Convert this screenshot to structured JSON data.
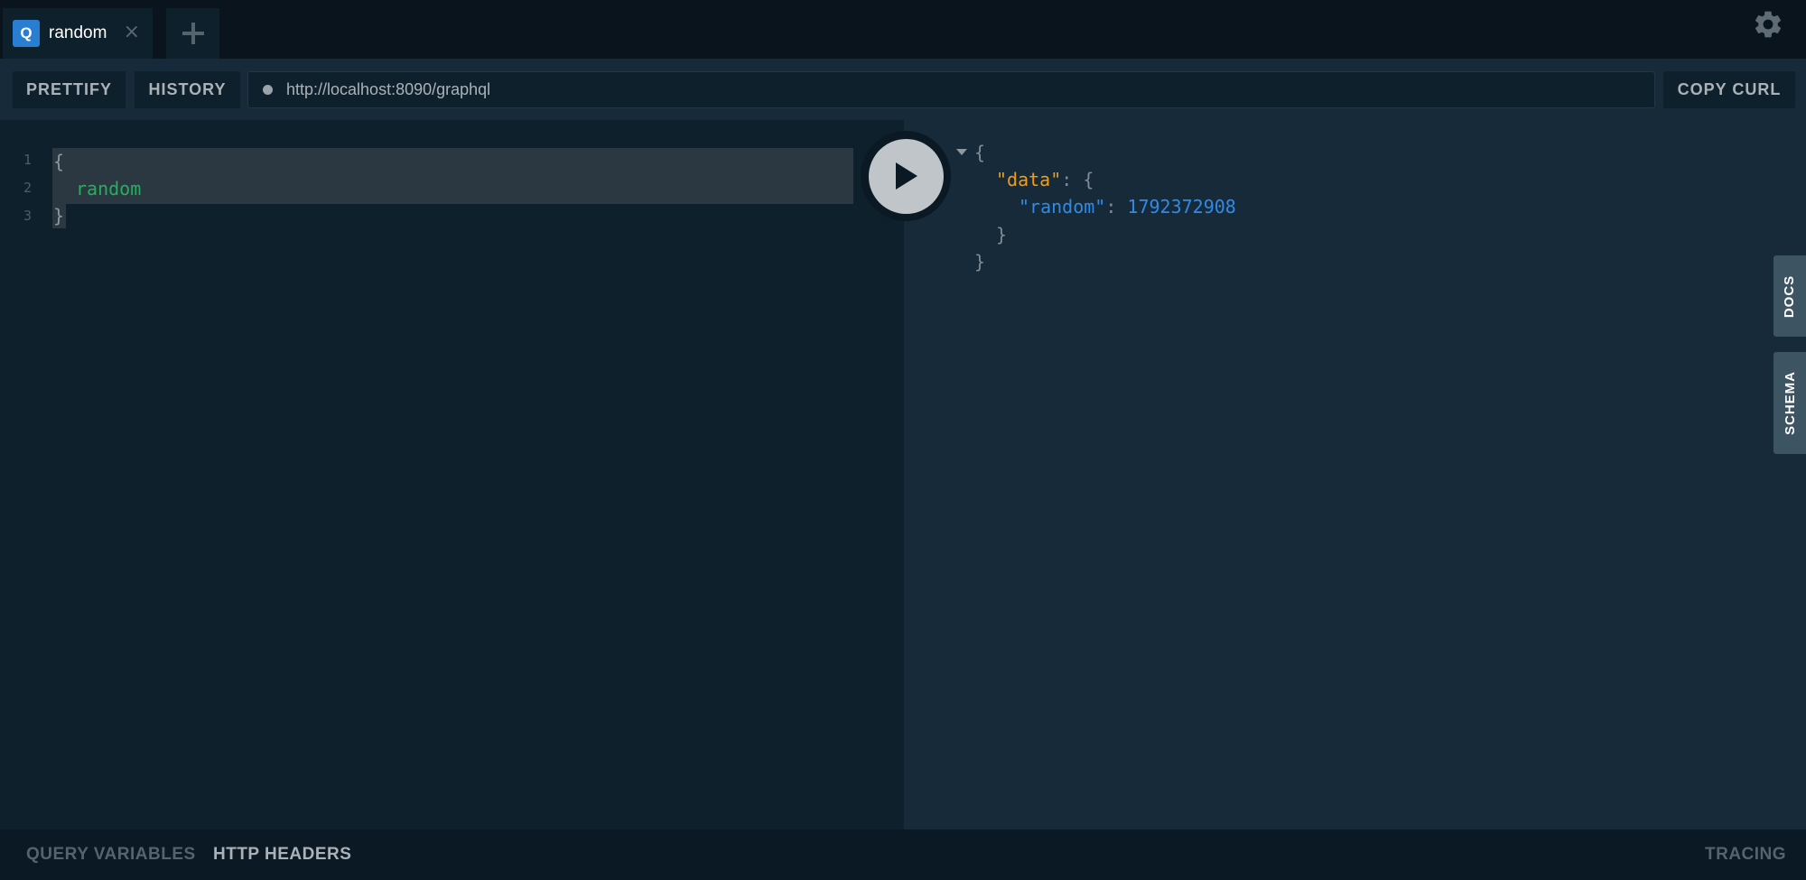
{
  "tabs": [
    {
      "badge": "Q",
      "title": "random",
      "close_icon": "close-icon"
    }
  ],
  "toolbar": {
    "prettify_label": "PRETTIFY",
    "history_label": "HISTORY",
    "url": "http://localhost:8090/graphql",
    "copy_curl_label": "COPY CURL"
  },
  "editor": {
    "line_numbers": [
      "1",
      "2",
      "3"
    ],
    "lines": [
      "{",
      "random",
      "}"
    ]
  },
  "result": {
    "open_brace": "{",
    "data_key": "\"data\"",
    "colon": ":",
    "data_open": "{",
    "random_key": "\"random\"",
    "random_value": "1792372908",
    "data_close": "}",
    "close_brace": "}"
  },
  "side_tabs": {
    "docs": "DOCS",
    "schema": "SCHEMA"
  },
  "bottom_bar": {
    "query_variables": "QUERY VARIABLES",
    "http_headers": "HTTP HEADERS",
    "tracing": "TRACING"
  },
  "colors": {
    "accent": "#2a7ed2",
    "keyword": "#27ae60",
    "json_key": "#f39c12",
    "json_number": "#2f8be6"
  }
}
